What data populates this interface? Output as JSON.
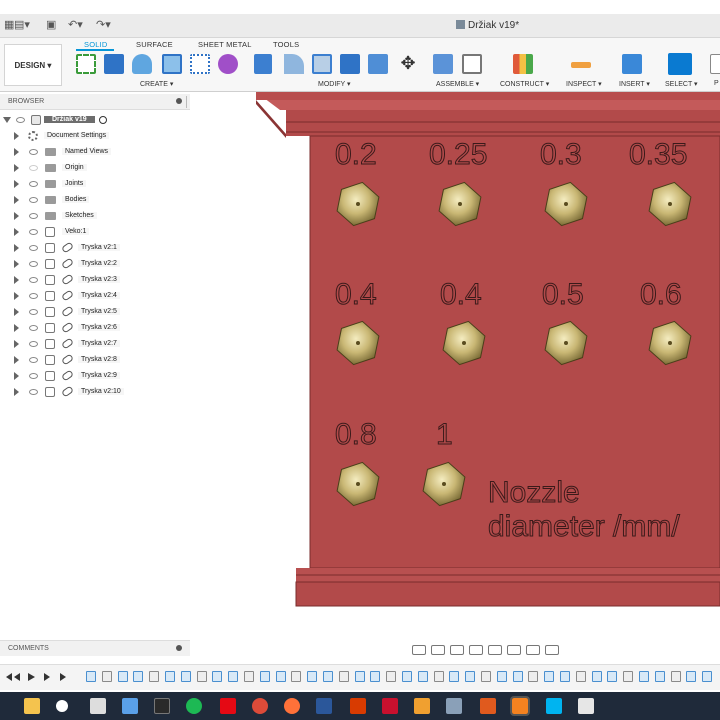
{
  "window": {
    "title": "Držiak v19*"
  },
  "toolbar": {
    "workspace": "DESIGN ▾",
    "tabs": [
      "SOLID",
      "SURFACE",
      "SHEET METAL",
      "TOOLS"
    ],
    "groups": [
      "CREATE ▾",
      "MODIFY ▾",
      "ASSEMBLE ▾",
      "CONSTRUCT ▾",
      "INSPECT ▾",
      "INSERT ▾",
      "SELECT ▾",
      "P"
    ]
  },
  "browser": {
    "title": "BROWSER",
    "root": "Držiak v19",
    "items": [
      {
        "label": "Document Settings",
        "icon": "gear-icon"
      },
      {
        "label": "Named Views",
        "icon": "folder-icon"
      },
      {
        "label": "Origin",
        "icon": "folder-icon"
      },
      {
        "label": "Joints",
        "icon": "folder-icon"
      },
      {
        "label": "Bodies",
        "icon": "folder-icon"
      },
      {
        "label": "Sketches",
        "icon": "folder-icon"
      },
      {
        "label": "Veko:1",
        "icon": "component-icon"
      },
      {
        "label": "Tryska v2:1",
        "icon": "link-icon"
      },
      {
        "label": "Tryska v2:2",
        "icon": "link-icon"
      },
      {
        "label": "Tryska v2:3",
        "icon": "link-icon"
      },
      {
        "label": "Tryska v2:4",
        "icon": "link-icon"
      },
      {
        "label": "Tryska v2:5",
        "icon": "link-icon"
      },
      {
        "label": "Tryska v2:6",
        "icon": "link-icon"
      },
      {
        "label": "Tryska v2:7",
        "icon": "link-icon"
      },
      {
        "label": "Tryska v2:8",
        "icon": "link-icon"
      },
      {
        "label": "Tryska v2:9",
        "icon": "link-icon"
      },
      {
        "label": "Tryska v2:10",
        "icon": "link-icon"
      }
    ]
  },
  "model": {
    "nozzle_labels": [
      "0.2",
      "0.25",
      "0.3",
      "0.35",
      "0.4",
      "0.4",
      "0.5",
      "0.6",
      "0.8",
      "1"
    ],
    "caption_line1": "Nozzle",
    "caption_line2": "diameter /mm/",
    "body_color": "#b24a4a",
    "nozzle_color": "#c9b774"
  },
  "comments": {
    "title": "COMMENTS"
  }
}
